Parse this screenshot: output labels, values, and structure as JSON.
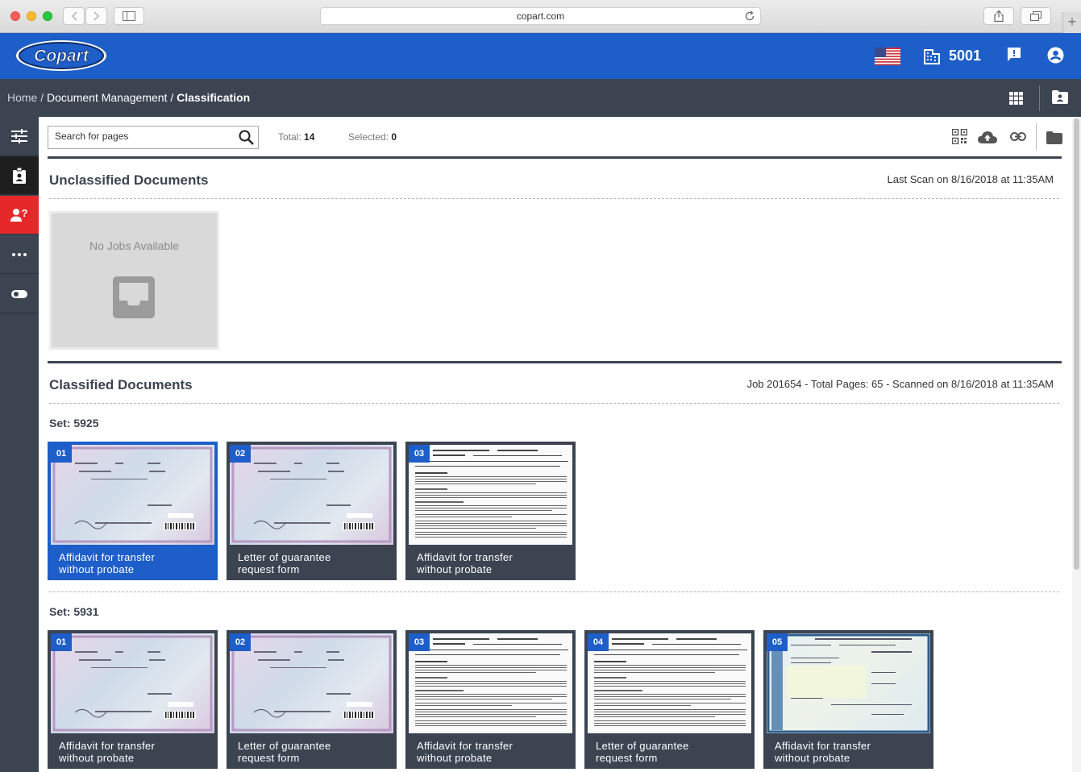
{
  "browser": {
    "url": "copart.com"
  },
  "header": {
    "logo_text": "Copart",
    "location_number": "5001"
  },
  "breadcrumb": {
    "home": "Home",
    "sep1": " / ",
    "section": "Document Management",
    "sep2": " / ",
    "current": "Classification"
  },
  "toolbar": {
    "search_placeholder": "Search for pages",
    "total_label": "Total: ",
    "total_value": "14",
    "selected_label": "Selected: ",
    "selected_value": "0"
  },
  "unclassified": {
    "title": "Unclassified Documents",
    "last_scan": "Last  Scan on 8/16/2018 at 11:35AM",
    "empty_text": "No Jobs Available"
  },
  "classified": {
    "title": "Classified Documents",
    "meta": "Job 201654  -  Total Pages: 65  -  Scanned on 8/16/2018 at 11:35AM",
    "sets": [
      {
        "label": "Set: 5925",
        "docs": [
          {
            "num": "01",
            "caption_1": "Affidavit for transfer",
            "caption_2": "without probate",
            "selected": true
          },
          {
            "num": "02",
            "caption_1": "Letter of guarantee",
            "caption_2": "request form",
            "selected": false
          },
          {
            "num": "03",
            "caption_1": "Affidavit for transfer",
            "caption_2": "without probate",
            "selected": false
          }
        ]
      },
      {
        "label": "Set: 5931",
        "docs": [
          {
            "num": "01",
            "caption_1": "Affidavit for transfer",
            "caption_2": "without probate",
            "selected": false
          },
          {
            "num": "02",
            "caption_1": "Letter of guarantee",
            "caption_2": "request form",
            "selected": false
          },
          {
            "num": "03",
            "caption_1": "Affidavit for transfer",
            "caption_2": "without probate",
            "selected": false
          },
          {
            "num": "04",
            "caption_1": "Letter of guarantee",
            "caption_2": "request form",
            "selected": false
          },
          {
            "num": "05",
            "caption_1": "Affidavit for transfer",
            "caption_2": "without probate",
            "selected": false
          }
        ]
      }
    ]
  },
  "icons": {
    "header": [
      "us-flag-icon",
      "building-icon",
      "feedback-icon",
      "account-icon"
    ],
    "rail": [
      "filters-icon",
      "assignment-icon",
      "help-user-icon",
      "more-icon",
      "toggle-icon"
    ],
    "toolbar": [
      "search-icon",
      "qr-code-icon",
      "cloud-upload-icon",
      "link-icon",
      "folder-icon"
    ]
  },
  "colors": {
    "brand_blue": "#1d5ec9",
    "dark_slate": "#3c4452",
    "alert_red": "#e7282a"
  }
}
